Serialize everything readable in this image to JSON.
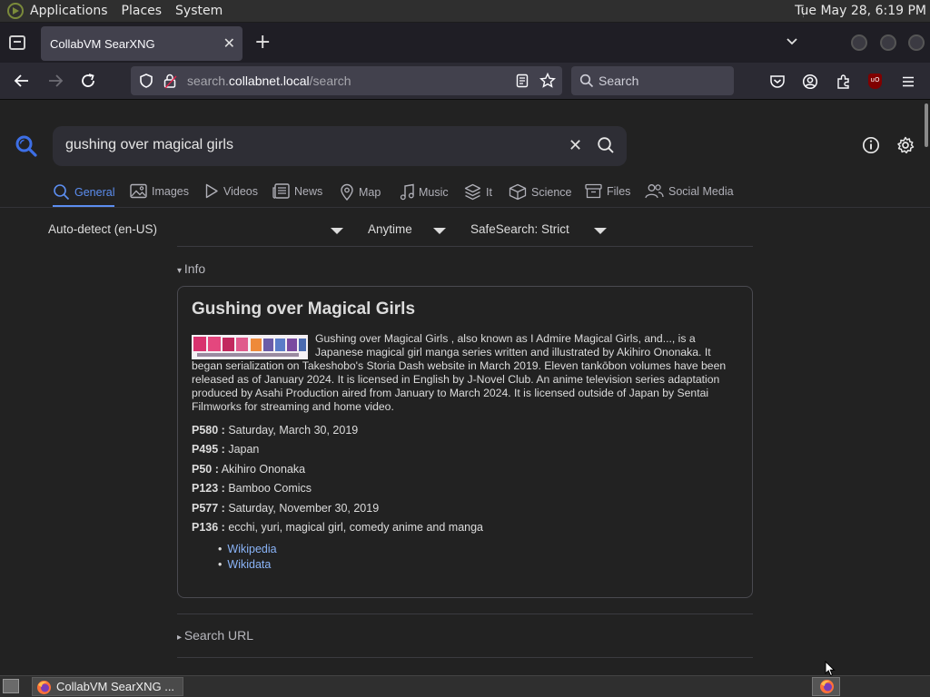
{
  "panel": {
    "menus": [
      "Applications",
      "Places",
      "System"
    ],
    "clock": "Tue May 28,  6:19 PM"
  },
  "browser": {
    "tab_title": "CollabVM SearXNG",
    "url_prefix": "search.",
    "url_domain": "collabnet.local",
    "url_path": "/search",
    "search_placeholder": "Search",
    "ublock_badge": "uO"
  },
  "searx": {
    "query": "gushing over magical girls",
    "categories": [
      {
        "label": "General",
        "icon": "search-icon",
        "active": true
      },
      {
        "label": "Images",
        "icon": "image-icon"
      },
      {
        "label": "Videos",
        "icon": "play-icon"
      },
      {
        "label": "News",
        "icon": "newspaper-icon"
      },
      {
        "label": "Map",
        "icon": "map-pin-icon"
      },
      {
        "label": "Music",
        "icon": "music-icon"
      },
      {
        "label": "It",
        "icon": "layers-icon"
      },
      {
        "label": "Science",
        "icon": "cube-icon"
      },
      {
        "label": "Files",
        "icon": "archive-icon"
      },
      {
        "label": "Social Media",
        "icon": "people-icon"
      }
    ],
    "filters": {
      "language": "Auto-detect (en-US)",
      "time": "Anytime",
      "safesearch": "SafeSearch: Strict"
    },
    "info_toggle": "Info",
    "infobox": {
      "title": "Gushing over Magical Girls",
      "description": "Gushing over Magical Girls , also known as I Admire Magical Girls, and..., is a Japanese magical girl manga series written and illustrated by Akihiro Ononaka. It began serialization on Takeshobo's Storia Dash website in March 2019. Eleven tankōbon volumes have been released as of January 2024. It is licensed in English by J-Novel Club. An anime television series adaptation produced by Asahi Production aired from January to March 2024. It is licensed outside of Japan by Sentai Filmworks for streaming and home video.",
      "attributes": [
        {
          "key": "P580 :",
          "value": "Saturday, March 30, 2019"
        },
        {
          "key": "P495 :",
          "value": "Japan"
        },
        {
          "key": "P50 :",
          "value": "Akihiro Ononaka"
        },
        {
          "key": "P123 :",
          "value": "Bamboo Comics"
        },
        {
          "key": "P577 :",
          "value": "Saturday, November 30, 2019"
        },
        {
          "key": "P136 :",
          "value": "ecchi, yuri, magical girl, comedy anime and manga"
        }
      ],
      "links": [
        "Wikipedia",
        "Wikidata"
      ]
    },
    "search_url_toggle": "Search URL"
  },
  "taskbar": {
    "task_label": "CollabVM SearXNG ..."
  },
  "colors": {
    "accent": "#5c8ef0",
    "link": "#8ab4f8",
    "background": "#222222"
  }
}
